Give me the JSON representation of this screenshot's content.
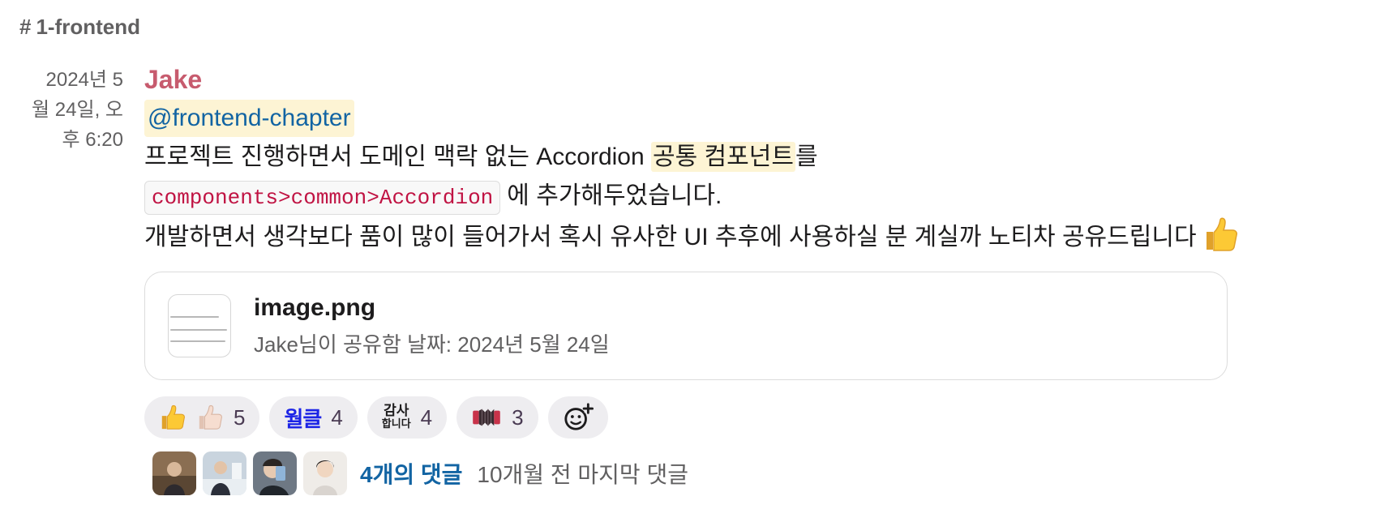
{
  "channel": {
    "name": "1-frontend"
  },
  "message": {
    "timestamp": "2024년 5월 24일, 오후 6:20",
    "timestamp_lines": [
      "2024년 5",
      "월 24일, 오",
      "후 6:20"
    ],
    "author": "Jake",
    "mention": "@frontend-chapter",
    "line1_pre": "프로젝트 진행하면서 도메인 맥락 없는 Accordion ",
    "line1_hl": "공통 컴포넌트",
    "line1_post": "를",
    "code": "components>common>Accordion",
    "line2_post": "에 추가해두었습니다.",
    "line3": "개발하면서 생각보다 품이 많이 들어가서 혹시 유사한 UI 추후에 사용하실 분 계실까 노티차 공유드립니다",
    "line3_emoji": "thumbs-up-icon"
  },
  "attachment": {
    "file_name": "image.png",
    "shared_by": "Jake님이 공유함 날짜: 2024년 5월 24일"
  },
  "reactions": [
    {
      "emoji": "thumbs-up-icon + thumbs-up-light-skin-icon",
      "count": "5"
    },
    {
      "emoji": "weolgeul-icon",
      "label": "월클",
      "count": "4"
    },
    {
      "emoji": "thanks-icon",
      "label_top": "감사",
      "label_bottom": "합니다",
      "count": "4"
    },
    {
      "emoji": "accordion-icon",
      "count": "3"
    }
  ],
  "thread": {
    "reply_count": "4개의 댓글",
    "last_reply": "10개월 전 마지막 댓글"
  },
  "colors": {
    "author": "#c75b6e",
    "mention": "#1264a3",
    "highlight": "#fdf4d4",
    "code": "#c01343",
    "reaction_bg": "#eeedf0"
  }
}
